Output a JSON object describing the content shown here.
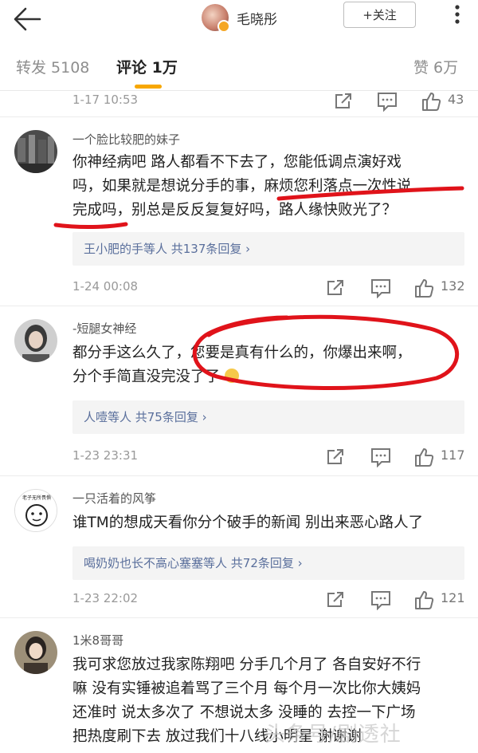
{
  "header": {
    "username": "毛晓彤",
    "follow_label": "+关注"
  },
  "tabs": [
    {
      "label": "转发 5108"
    },
    {
      "label": "评论 1万"
    },
    {
      "label": "赞 6万"
    }
  ],
  "top_meta": {
    "time": "1-17 10:53",
    "likes": "43"
  },
  "comments": [
    {
      "name": "一个脸比较肥的妹子",
      "lines": [
        "你神经病吧 路人都看不下去了，您能低调点演好戏",
        "吗，如果就是想说分手的事，麻烦您利落点一次性说",
        "完成吗，别总是反反复复好吗，路人缘快败光了？"
      ],
      "reply": "王小肥的手等人 共137条回复 ›",
      "time": "1-24 00:08",
      "likes": "132"
    },
    {
      "name": "-短腿女神经",
      "lines": [
        "都分手这么久了，您要是真有什么的，你爆出来啊，",
        "分个手简直没完没了了"
      ],
      "reply": "人噎等人 共75条回复 ›",
      "time": "1-23 23:31",
      "likes": "117"
    },
    {
      "name": "一只活着的风筝",
      "lines": [
        "谁TM的想成天看你分个破手的新闻 别出来恶心路人了"
      ],
      "reply": "喝奶奶也长不高心塞塞等人 共72条回复 ›",
      "time": "1-23 22:02",
      "likes": "121",
      "avatar_caption": "老子无所畏惧"
    },
    {
      "name": "1米8哥哥",
      "lines": [
        "我可求您放过我家陈翔吧 分手几个月了 各自安好不行",
        "嘛 没有实锤被追着骂了三个月 每个月一次比你大姨妈",
        "还准时 说太多次了 不想说太多 没睡的 去控一下广场",
        "把热度刷下去 放过我们十八线小明星 谢谢谢"
      ]
    }
  ],
  "watermark": "头条号/剧透社",
  "colors": {
    "accent": "#f7a700",
    "link": "#5a6f9c",
    "ink": "#e0131a"
  }
}
